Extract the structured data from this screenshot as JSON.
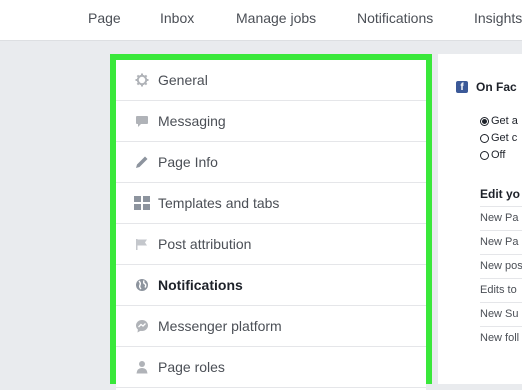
{
  "topnav": {
    "items": [
      "Page",
      "Inbox",
      "Manage jobs",
      "Notifications",
      "Insights"
    ]
  },
  "sidebar": {
    "items": [
      {
        "label": "General",
        "icon": "gear-icon"
      },
      {
        "label": "Messaging",
        "icon": "chat-icon"
      },
      {
        "label": "Page Info",
        "icon": "pencil-icon"
      },
      {
        "label": "Templates and tabs",
        "icon": "grid-icon"
      },
      {
        "label": "Post attribution",
        "icon": "flag-icon"
      },
      {
        "label": "Notifications",
        "icon": "globe-icon",
        "active": true
      },
      {
        "label": "Messenger platform",
        "icon": "messenger-icon"
      },
      {
        "label": "Page roles",
        "icon": "person-icon"
      }
    ],
    "highlight_color": "#39e83a"
  },
  "content": {
    "section_title": "On Fac",
    "radio_options": [
      {
        "label": "Get a",
        "checked": true
      },
      {
        "label": "Get c",
        "checked": false
      },
      {
        "label": "Off",
        "checked": false
      }
    ],
    "edit_title": "Edit yo",
    "events": [
      "New Pa",
      "New Pa",
      "New pos",
      "Edits to",
      "New Su",
      "New foll"
    ]
  },
  "colors": {
    "facebook_blue": "#3b5998",
    "background": "#e9ebee"
  }
}
